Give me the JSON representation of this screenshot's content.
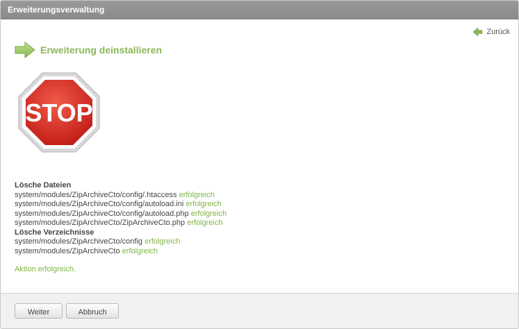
{
  "window": {
    "title": "Erweiterungsverwaltung"
  },
  "nav": {
    "back_label": "Zurück"
  },
  "headline": "Erweiterung deinstallieren",
  "stop_sign": {
    "text": "STOP"
  },
  "files_section": {
    "title": "Lösche Dateien",
    "items": [
      {
        "path": "system/modules/ZipArchiveCto/config/.htaccess",
        "status": "erfolgreich"
      },
      {
        "path": "system/modules/ZipArchiveCto/config/autoload.ini",
        "status": "erfolgreich"
      },
      {
        "path": "system/modules/ZipArchiveCto/config/autoload.php",
        "status": "erfolgreich"
      },
      {
        "path": "system/modules/ZipArchiveCto/ZipArchiveCto.php",
        "status": "erfolgreich"
      }
    ]
  },
  "dirs_section": {
    "title": "Lösche Verzeichnisse",
    "items": [
      {
        "path": "system/modules/ZipArchiveCto/config",
        "status": "erfolgreich"
      },
      {
        "path": "system/modules/ZipArchiveCto",
        "status": "erfolgreich"
      }
    ]
  },
  "result_text": "Aktion erfolgreich.",
  "footer": {
    "continue_label": "Weiter",
    "cancel_label": "Abbruch"
  },
  "colors": {
    "accent_green": "#8ab858",
    "success_green": "#7fb445",
    "titlebar": "#8f8f8f",
    "stop_red": "#d8241e"
  }
}
